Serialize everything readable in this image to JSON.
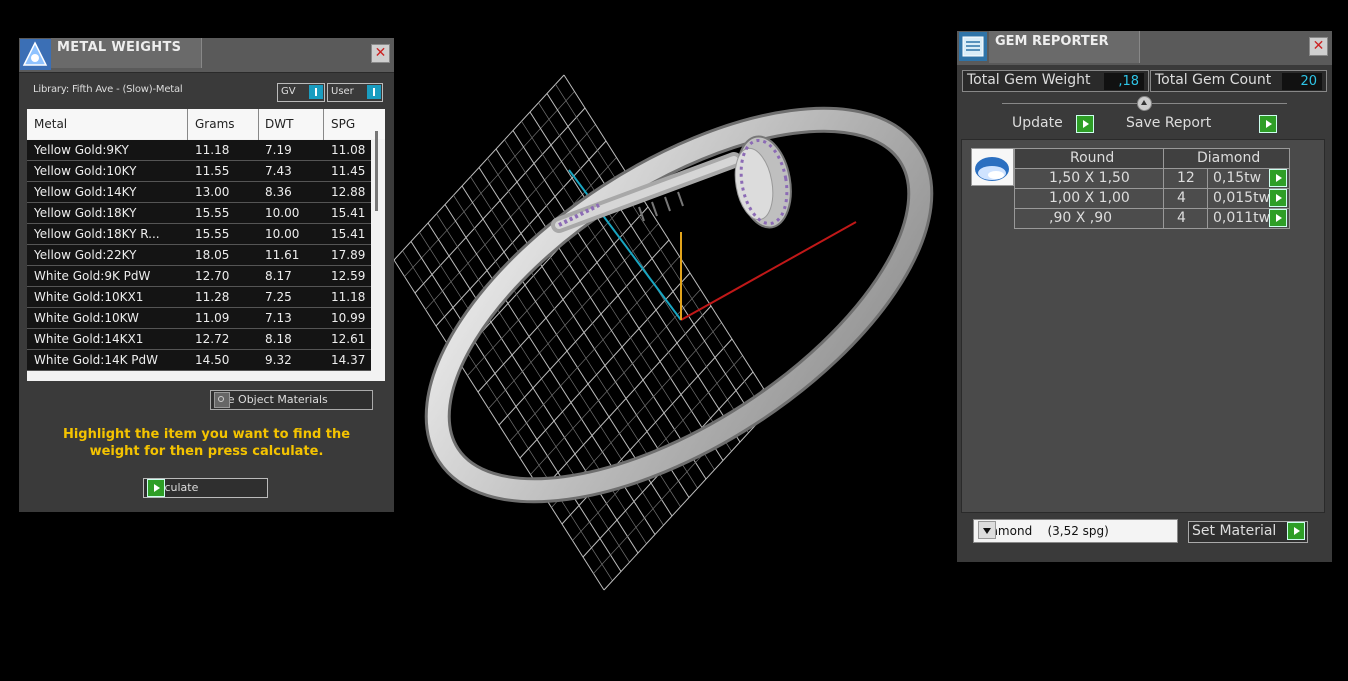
{
  "metal_weights": {
    "title": "METAL WEIGHTS",
    "close_icon": "close-icon",
    "library_label": "Library: Fifth Ave - (Slow)-Metal",
    "toggle_gv": "GV",
    "toggle_user": "User",
    "columns": [
      "Metal",
      "Grams",
      "DWT",
      "SPG"
    ],
    "rows": [
      {
        "metal": "Yellow Gold:9KY",
        "grams": "11.18",
        "dwt": "7.19",
        "spg": "11.08"
      },
      {
        "metal": "Yellow Gold:10KY",
        "grams": "11.55",
        "dwt": "7.43",
        "spg": "11.45"
      },
      {
        "metal": "Yellow Gold:14KY",
        "grams": "13.00",
        "dwt": "8.36",
        "spg": "12.88"
      },
      {
        "metal": "Yellow Gold:18KY",
        "grams": "15.55",
        "dwt": "10.00",
        "spg": "15.41"
      },
      {
        "metal": "Yellow Gold:18KY R...",
        "grams": "15.55",
        "dwt": "10.00",
        "spg": "15.41"
      },
      {
        "metal": "Yellow Gold:22KY",
        "grams": "18.05",
        "dwt": "11.61",
        "spg": "17.89"
      },
      {
        "metal": "White Gold:9K PdW",
        "grams": "12.70",
        "dwt": "8.17",
        "spg": "12.59"
      },
      {
        "metal": "White Gold:10KX1",
        "grams": "11.28",
        "dwt": "7.25",
        "spg": "11.18"
      },
      {
        "metal": "White Gold:10KW",
        "grams": "11.09",
        "dwt": "7.13",
        "spg": "10.99"
      },
      {
        "metal": "White Gold:14KX1",
        "grams": "12.72",
        "dwt": "8.18",
        "spg": "12.61"
      },
      {
        "metal": "White Gold:14K PdW",
        "grams": "14.50",
        "dwt": "9.32",
        "spg": "14.37"
      }
    ],
    "use_object_materials": "Use Object Materials",
    "hint": "Highlight the item you want to find the weight for then press calculate.",
    "calculate_label": "Calculate"
  },
  "gem_reporter": {
    "title": "GEM REPORTER",
    "total_weight_label": "Total Gem Weight",
    "total_weight_value": ",18",
    "total_count_label": "Total Gem Count",
    "total_count_value": "20",
    "update_label": "Update",
    "save_report_label": "Save Report",
    "gem_shape": "Round",
    "gem_material": "Diamond",
    "gems": [
      {
        "size": "1,50 X 1,50",
        "count": "12",
        "weight": "0,15tw"
      },
      {
        "size": "1,00 X 1,00",
        "count": "4",
        "weight": "0,015tw"
      },
      {
        "size": ",90 X ,90",
        "count": "4",
        "weight": "0,011tw"
      }
    ],
    "material_select": "Diamond    (3,52 spg)",
    "set_material_label": "Set Material"
  },
  "colors": {
    "accent_cyan": "#2ec4e6",
    "hint_yellow": "#f4c300",
    "go_green": "#2e9e26"
  }
}
